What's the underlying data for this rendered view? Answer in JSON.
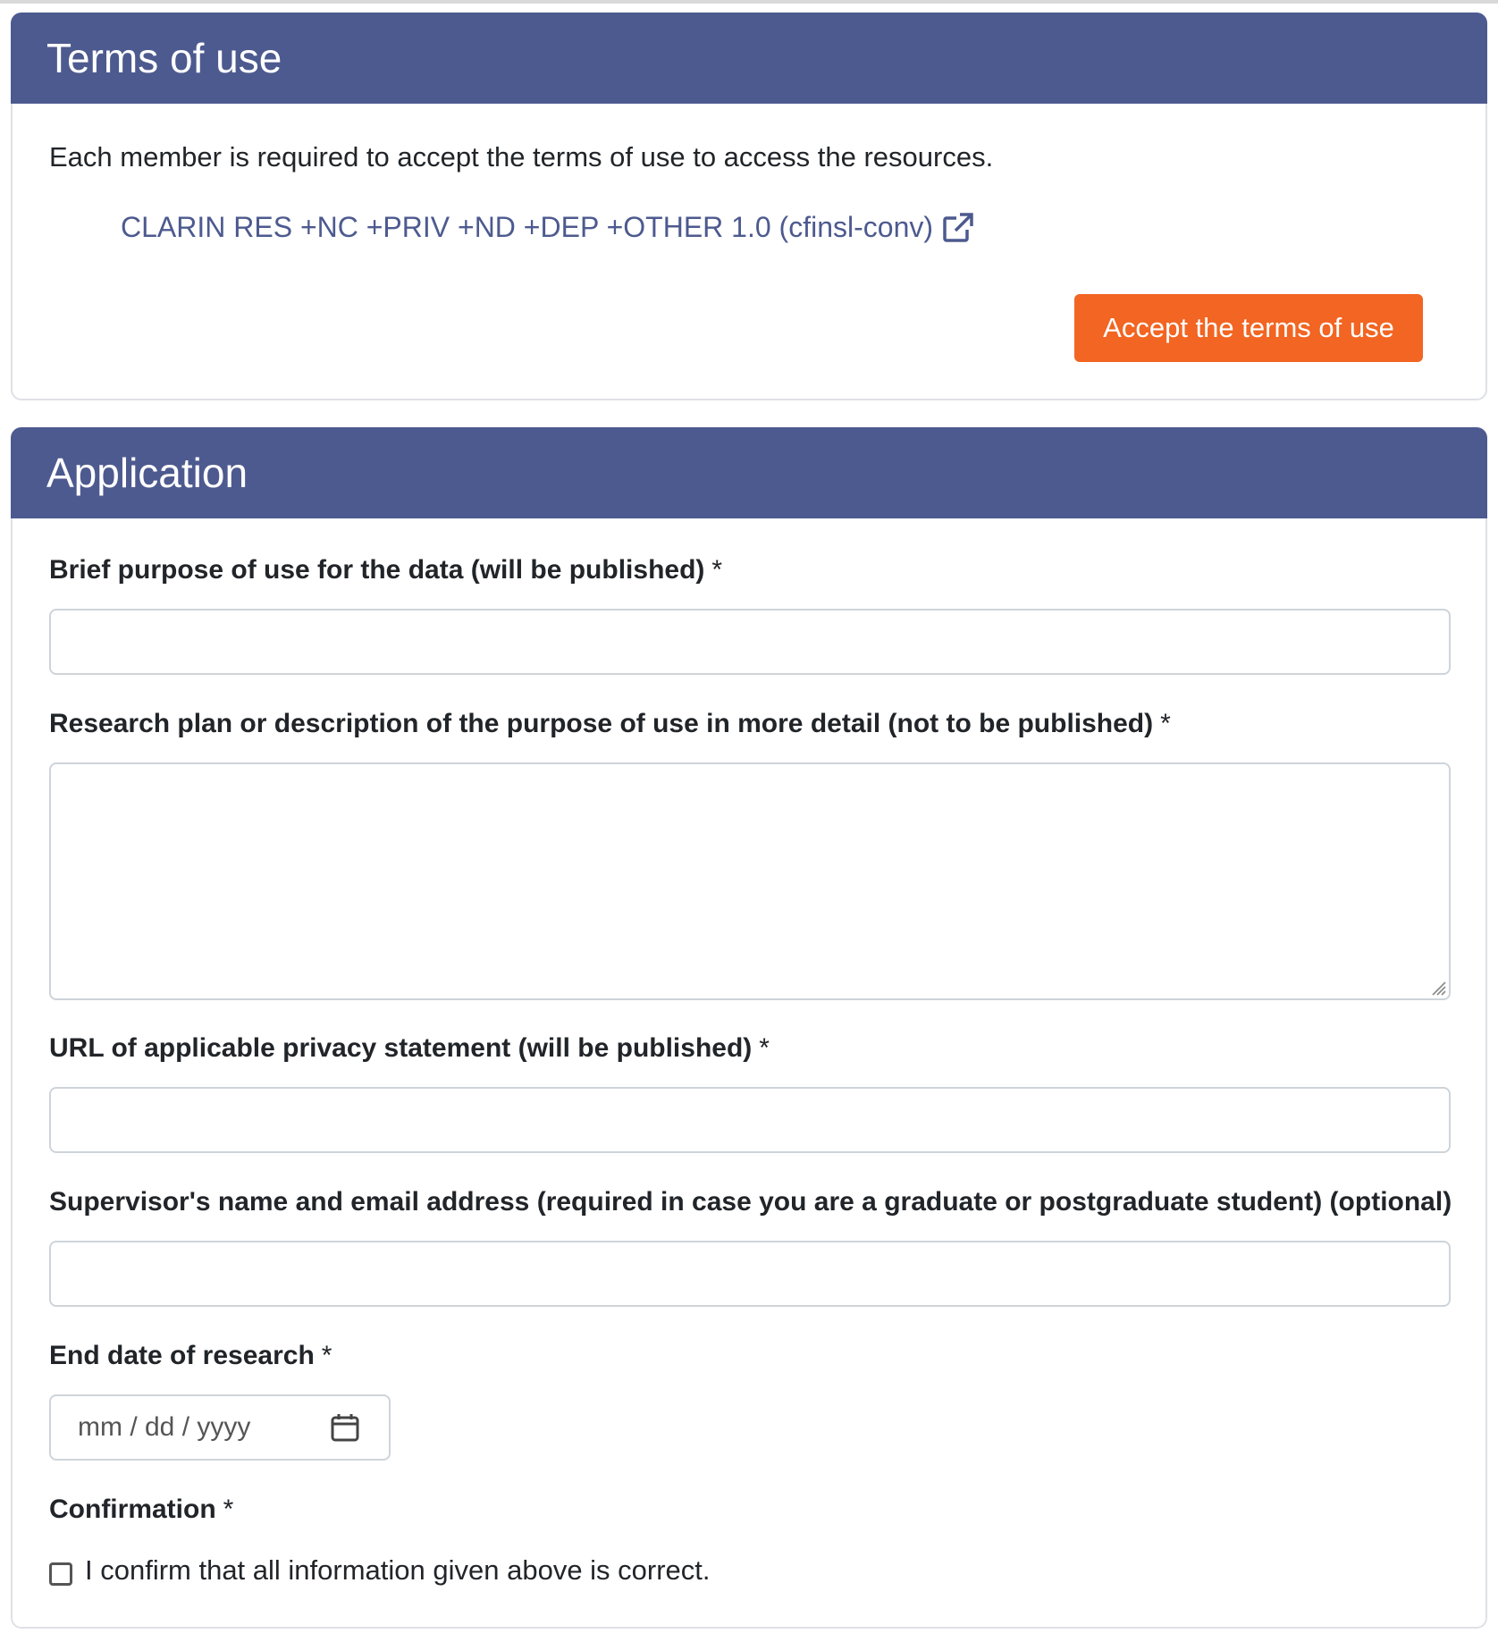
{
  "terms": {
    "title": "Terms of use",
    "intro": "Each member is required to accept the terms of use to access the resources.",
    "license_link": "CLARIN RES +NC +PRIV +ND +DEP +OTHER 1.0 (cfinsl-conv)",
    "accept_button": "Accept the terms of use"
  },
  "application": {
    "title": "Application",
    "required_marker": "*",
    "fields": {
      "purpose": {
        "label": "Brief purpose of use for the data (will be published)",
        "value": ""
      },
      "research_plan": {
        "label": "Research plan or description of the purpose of use in more detail (not to be published)",
        "value": ""
      },
      "privacy_url": {
        "label": "URL of applicable privacy statement (will be published)",
        "value": ""
      },
      "supervisor": {
        "label": "Supervisor's name and email address (required in case you are a graduate or postgraduate student) (optional)",
        "value": ""
      },
      "end_date": {
        "label": "End date of research",
        "placeholder": "mm / dd / yyyy"
      },
      "confirmation": {
        "label": "Confirmation",
        "checkbox_label": "I confirm that all information given above is correct.",
        "checked": false
      }
    }
  },
  "colors": {
    "header_bg": "#4d5a8f",
    "link": "#4d5a8f",
    "accent_button": "#f26522",
    "border": "#ced4da"
  },
  "icons": {
    "license_link": "external-link-icon",
    "date": "calendar-icon"
  }
}
